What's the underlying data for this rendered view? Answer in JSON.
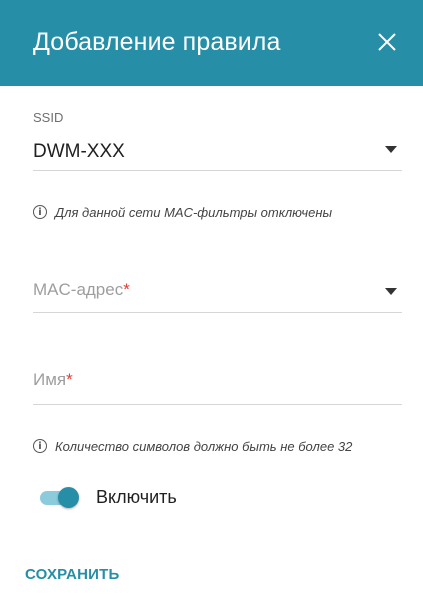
{
  "dialog": {
    "title": "Добавление правила",
    "close_icon": "close-icon"
  },
  "ssid": {
    "label": "SSID",
    "value": "DWM-XXX",
    "hint": "Для данной сети MAC-фильтры отключены"
  },
  "mac": {
    "placeholder": "MAC-адрес",
    "required_mark": "*"
  },
  "name": {
    "placeholder": "Имя",
    "required_mark": "*",
    "hint": "Количество символов должно быть не более 32"
  },
  "enable": {
    "label": "Включить",
    "checked": true
  },
  "actions": {
    "save_label": "СОХРАНИТЬ"
  },
  "colors": {
    "accent": "#268ea7",
    "required": "#e53935"
  }
}
